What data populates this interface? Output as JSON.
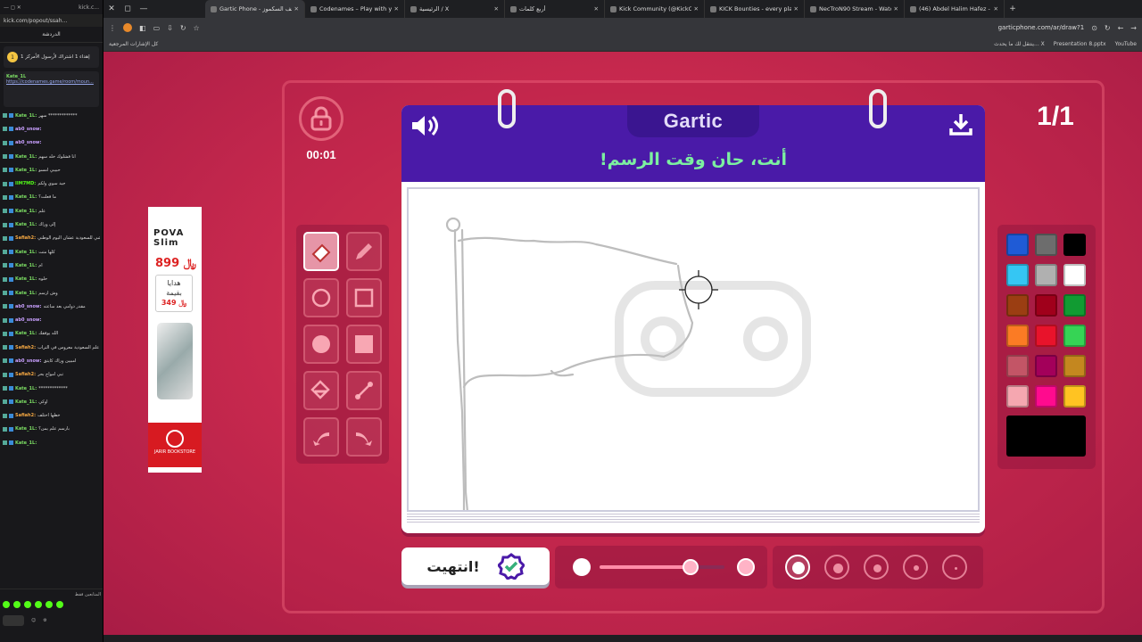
{
  "browser": {
    "tabs": [
      {
        "label": "Gartic Phone - الهاتف السكموز",
        "active": true
      },
      {
        "label": "Codenames – Play with your F..."
      },
      {
        "label": "الرئيسية / X"
      },
      {
        "label": "أربع كلمات"
      },
      {
        "label": "Kick Community (@KickComm..."
      },
      {
        "label": "KICK Bounties - every player fo..."
      },
      {
        "label": "NecTroN90 Stream - Watch Liv..."
      },
      {
        "label": "(46) Abdel Halim Hafez - A..."
      }
    ],
    "url": "garticphone.com/ar/draw?1",
    "bookmarks_all": "كل الإشارات المرجعية",
    "bookmarks": [
      "ينتقل لك ما يحدث... X",
      "Presentation 8.pptx",
      "YouTube"
    ]
  },
  "chat": {
    "popout_url": "kick.com/popout/ssah...",
    "title": "الدردشة",
    "pinned_badge": "1",
    "pinned_text": "إهداء 1 اشتراك لأرسول الأمركز 1",
    "pinned_msg_user": "Kate_1L",
    "pinned_msg_link": "https://codenames.game/room/moun...",
    "messages": [
      {
        "user": "Kate_1L:",
        "text": "سهر *************",
        "color": "#7ddf64"
      },
      {
        "user": "ab0_snow:",
        "text": "",
        "color": "#c9a0ff"
      },
      {
        "user": "ab0_snow:",
        "text": "",
        "color": "#c9a0ff"
      },
      {
        "user": "Kate_1L:",
        "text": "انا فشلوك خله سهم",
        "color": "#7ddf64"
      },
      {
        "user": "Kate_1L:",
        "text": "حبيبي امسو",
        "color": "#7ddf64"
      },
      {
        "user": "IIM7MD:",
        "text": "جيد سوي ولكم",
        "color": "#53fc18"
      },
      {
        "user": "Kate_1L:",
        "text": "ما فعلت؟",
        "color": "#7ddf64"
      },
      {
        "user": "Kate_1L:",
        "text": "علم",
        "color": "#7ddf64"
      },
      {
        "user": "Kate_1L:",
        "text": "إلى وراك",
        "color": "#7ddf64"
      },
      {
        "user": "Safiah2:",
        "text": "ارسم شي للسعودية عشان اليوم الوطني",
        "color": "#f4a742"
      },
      {
        "user": "Kate_1L:",
        "text": "كلها متت",
        "color": "#7ddf64"
      },
      {
        "user": "Kate_1L:",
        "text": "ام",
        "color": "#7ddf64"
      },
      {
        "user": "Kate_1L:",
        "text": "حلوه",
        "color": "#7ddf64"
      },
      {
        "user": "Kate_1L:",
        "text": "وش ارسم",
        "color": "#7ddf64"
      },
      {
        "user": "ab0_snow:",
        "text": "مقدر دوامي بعد ساعته",
        "color": "#c9a0ff"
      },
      {
        "user": "ab0_snow:",
        "text": "",
        "color": "#c9a0ff"
      },
      {
        "user": "Kate_1L:",
        "text": "الله يوفقك",
        "color": "#7ddf64"
      },
      {
        "user": "Safiah2:",
        "text": "ارسم صحراء و جمال و نخل في ظلال و في القمس علم السعودية معروس في التراب",
        "color": "#f4a742"
      },
      {
        "user": "ab0_snow:",
        "text": "امبيين وراك كايتق",
        "color": "#c9a0ff"
      },
      {
        "user": "Safiah2:",
        "text": "تبي امواج بحر",
        "color": "#f4a742"
      },
      {
        "user": "Kate_1L:",
        "text": "*************",
        "color": "#7ddf64"
      },
      {
        "user": "Kate_1L:",
        "text": "اوكي",
        "color": "#7ddf64"
      },
      {
        "user": "Safiah2:",
        "text": "خطها احتلف",
        "color": "#f4a742"
      },
      {
        "user": "Kate_1L:",
        "text": "بارسم علم يمن؟",
        "color": "#7ddf64"
      },
      {
        "user": "Kate_1L:",
        "text": "",
        "color": "#7ddf64"
      }
    ],
    "footer_label": "المتابعين فقط"
  },
  "ad": {
    "brand": "POVA Slim",
    "price_main": "899 ﷼",
    "gift_line1": "هدايا",
    "gift_line2": "بقيمة",
    "gift_price": "349 ﷼",
    "store": "JARIR BOOKSTORE"
  },
  "game": {
    "timer": "00:01",
    "counter": "1/1",
    "logo": "Gartic",
    "instruction": "أنت، حان وقت الرسم!",
    "done_label": "انتهيت!",
    "tools": [
      {
        "name": "eraser-tool",
        "selected": true
      },
      {
        "name": "pencil-tool"
      },
      {
        "name": "ellipse-outline-tool"
      },
      {
        "name": "rectangle-outline-tool"
      },
      {
        "name": "ellipse-filled-tool"
      },
      {
        "name": "rectangle-filled-tool"
      },
      {
        "name": "fill-bucket-tool"
      },
      {
        "name": "line-tool"
      },
      {
        "name": "undo-tool"
      },
      {
        "name": "redo-tool"
      }
    ],
    "colors": [
      "#1f5bd6",
      "#6d6d6d",
      "#000000",
      "#35c6f3",
      "#b0b0b0",
      "#ffffff",
      "#9b3e12",
      "#a0001b",
      "#119b32",
      "#fb7b24",
      "#e8132b",
      "#36d455",
      "#c35566",
      "#a3005a",
      "#c4871f",
      "#f5a7b0",
      "#ff0b8e",
      "#ffc322"
    ],
    "current_color": "#000000",
    "opacity_level": 0.73,
    "selected_brush_size": 1
  }
}
